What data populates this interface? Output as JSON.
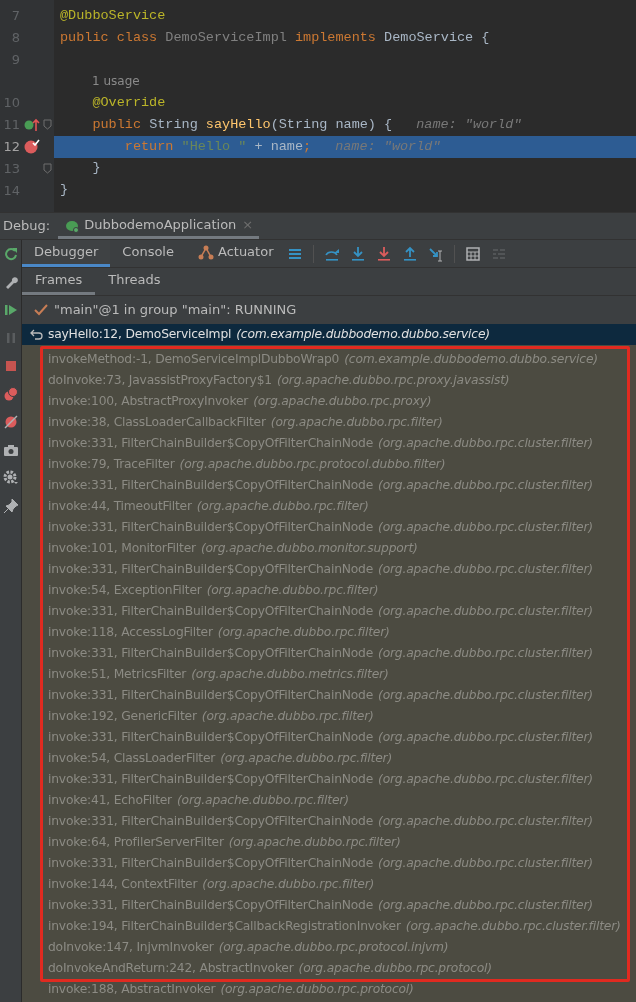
{
  "editor": {
    "lines": [
      {
        "number": "7",
        "selected": false,
        "tokens": [
          {
            "text": "@DubboService",
            "kind": "annotation"
          }
        ]
      },
      {
        "number": "8",
        "selected": false,
        "tokens": [
          {
            "text": "public class ",
            "kind": "keyword"
          },
          {
            "text": "DemoServiceImpl ",
            "kind": "unused"
          },
          {
            "text": "implements ",
            "kind": "keyword"
          },
          {
            "text": "DemoService {",
            "kind": "plain"
          }
        ]
      },
      {
        "number": "9",
        "selected": false
      },
      {
        "selected": false,
        "usage": "1 usage"
      },
      {
        "number": "10",
        "selected": false,
        "tokens": [
          {
            "text": "    @Override",
            "kind": "annotation"
          }
        ]
      },
      {
        "number": "11",
        "selected": false,
        "markers": [
          {
            "kind": "implements"
          },
          {
            "kind": "fold"
          }
        ],
        "tokens": [
          {
            "text": "    public ",
            "kind": "keyword"
          },
          {
            "text": "String ",
            "kind": "plain"
          },
          {
            "text": "sayHello",
            "kind": "method"
          },
          {
            "text": "(String name) {",
            "kind": "plain"
          },
          {
            "text": "name: \"world\"",
            "kind": "hint"
          }
        ]
      },
      {
        "number": "12",
        "selected": true,
        "markers": [
          {
            "kind": "breakpoint"
          }
        ],
        "tokens": [
          {
            "text": "        return ",
            "kind": "keyword"
          },
          {
            "text": "\"Hello \"",
            "kind": "string"
          },
          {
            "text": " + name",
            "kind": "plain"
          },
          {
            "text": ";",
            "kind": "keyword"
          },
          {
            "text": "name: \"world\"",
            "kind": "hint"
          }
        ]
      },
      {
        "number": "13",
        "selected": false,
        "markers": [
          {
            "kind": "fold"
          }
        ],
        "tokens": [
          {
            "text": "    }",
            "kind": "plain"
          }
        ]
      },
      {
        "number": "14",
        "selected": false,
        "tokens": [
          {
            "text": "}",
            "kind": "plain"
          }
        ]
      }
    ]
  },
  "debug": {
    "label": "Debug:",
    "session_tab": {
      "title": "DubbodemoApplication",
      "close": "×"
    },
    "tabs": [
      {
        "label": "Debugger",
        "selected": true,
        "kind": "plain"
      },
      {
        "label": "Console",
        "selected": false,
        "kind": "plain"
      },
      {
        "label": "Actuator",
        "selected": false,
        "kind": "plugin"
      }
    ],
    "subtabs": [
      {
        "label": "Frames",
        "selected": true
      },
      {
        "label": "Threads",
        "selected": false
      }
    ],
    "thread": "\"main\"@1 in group \"main\": RUNNING",
    "frames": [
      {
        "method": "sayHello:12, DemoServiceImpl",
        "package": "(com.example.dubbodemo.dubbo.service)",
        "selected": true
      },
      {
        "method": "invokeMethod:-1, DemoServiceImplDubboWrap0",
        "package": "(com.example.dubbodemo.dubbo.service)",
        "selected": false
      },
      {
        "method": "doInvoke:73, JavassistProxyFactory$1",
        "package": "(org.apache.dubbo.rpc.proxy.javassist)",
        "selected": false
      },
      {
        "method": "invoke:100, AbstractProxyInvoker",
        "package": "(org.apache.dubbo.rpc.proxy)",
        "selected": false
      },
      {
        "method": "invoke:38, ClassLoaderCallbackFilter",
        "package": "(org.apache.dubbo.rpc.filter)",
        "selected": false
      },
      {
        "method": "invoke:331, FilterChainBuilder$CopyOfFilterChainNode",
        "package": "(org.apache.dubbo.rpc.cluster.filter)",
        "selected": false
      },
      {
        "method": "invoke:79, TraceFilter",
        "package": "(org.apache.dubbo.rpc.protocol.dubbo.filter)",
        "selected": false
      },
      {
        "method": "invoke:331, FilterChainBuilder$CopyOfFilterChainNode",
        "package": "(org.apache.dubbo.rpc.cluster.filter)",
        "selected": false
      },
      {
        "method": "invoke:44, TimeoutFilter",
        "package": "(org.apache.dubbo.rpc.filter)",
        "selected": false
      },
      {
        "method": "invoke:331, FilterChainBuilder$CopyOfFilterChainNode",
        "package": "(org.apache.dubbo.rpc.cluster.filter)",
        "selected": false
      },
      {
        "method": "invoke:101, MonitorFilter",
        "package": "(org.apache.dubbo.monitor.support)",
        "selected": false
      },
      {
        "method": "invoke:331, FilterChainBuilder$CopyOfFilterChainNode",
        "package": "(org.apache.dubbo.rpc.cluster.filter)",
        "selected": false
      },
      {
        "method": "invoke:54, ExceptionFilter",
        "package": "(org.apache.dubbo.rpc.filter)",
        "selected": false
      },
      {
        "method": "invoke:331, FilterChainBuilder$CopyOfFilterChainNode",
        "package": "(org.apache.dubbo.rpc.cluster.filter)",
        "selected": false
      },
      {
        "method": "invoke:118, AccessLogFilter",
        "package": "(org.apache.dubbo.rpc.filter)",
        "selected": false
      },
      {
        "method": "invoke:331, FilterChainBuilder$CopyOfFilterChainNode",
        "package": "(org.apache.dubbo.rpc.cluster.filter)",
        "selected": false
      },
      {
        "method": "invoke:51, MetricsFilter",
        "package": "(org.apache.dubbo.metrics.filter)",
        "selected": false
      },
      {
        "method": "invoke:331, FilterChainBuilder$CopyOfFilterChainNode",
        "package": "(org.apache.dubbo.rpc.cluster.filter)",
        "selected": false
      },
      {
        "method": "invoke:192, GenericFilter",
        "package": "(org.apache.dubbo.rpc.filter)",
        "selected": false
      },
      {
        "method": "invoke:331, FilterChainBuilder$CopyOfFilterChainNode",
        "package": "(org.apache.dubbo.rpc.cluster.filter)",
        "selected": false
      },
      {
        "method": "invoke:54, ClassLoaderFilter",
        "package": "(org.apache.dubbo.rpc.filter)",
        "selected": false
      },
      {
        "method": "invoke:331, FilterChainBuilder$CopyOfFilterChainNode",
        "package": "(org.apache.dubbo.rpc.cluster.filter)",
        "selected": false
      },
      {
        "method": "invoke:41, EchoFilter",
        "package": "(org.apache.dubbo.rpc.filter)",
        "selected": false
      },
      {
        "method": "invoke:331, FilterChainBuilder$CopyOfFilterChainNode",
        "package": "(org.apache.dubbo.rpc.cluster.filter)",
        "selected": false
      },
      {
        "method": "invoke:64, ProfilerServerFilter",
        "package": "(org.apache.dubbo.rpc.filter)",
        "selected": false
      },
      {
        "method": "invoke:331, FilterChainBuilder$CopyOfFilterChainNode",
        "package": "(org.apache.dubbo.rpc.cluster.filter)",
        "selected": false
      },
      {
        "method": "invoke:144, ContextFilter",
        "package": "(org.apache.dubbo.rpc.filter)",
        "selected": false
      },
      {
        "method": "invoke:331, FilterChainBuilder$CopyOfFilterChainNode",
        "package": "(org.apache.dubbo.rpc.cluster.filter)",
        "selected": false
      },
      {
        "method": "invoke:194, FilterChainBuilder$CallbackRegistrationInvoker",
        "package": "(org.apache.dubbo.rpc.cluster.filter)",
        "selected": false
      },
      {
        "method": "doInvoke:147, InjvmInvoker",
        "package": "(org.apache.dubbo.rpc.protocol.injvm)",
        "selected": false
      },
      {
        "method": "doInvokeAndReturn:242, AbstractInvoker",
        "package": "(org.apache.dubbo.rpc.protocol)",
        "selected": false
      },
      {
        "method": "invoke:188, AbstractInvoker",
        "package": "(org.apache.dubbo.rpc.protocol)",
        "selected": false
      }
    ]
  }
}
